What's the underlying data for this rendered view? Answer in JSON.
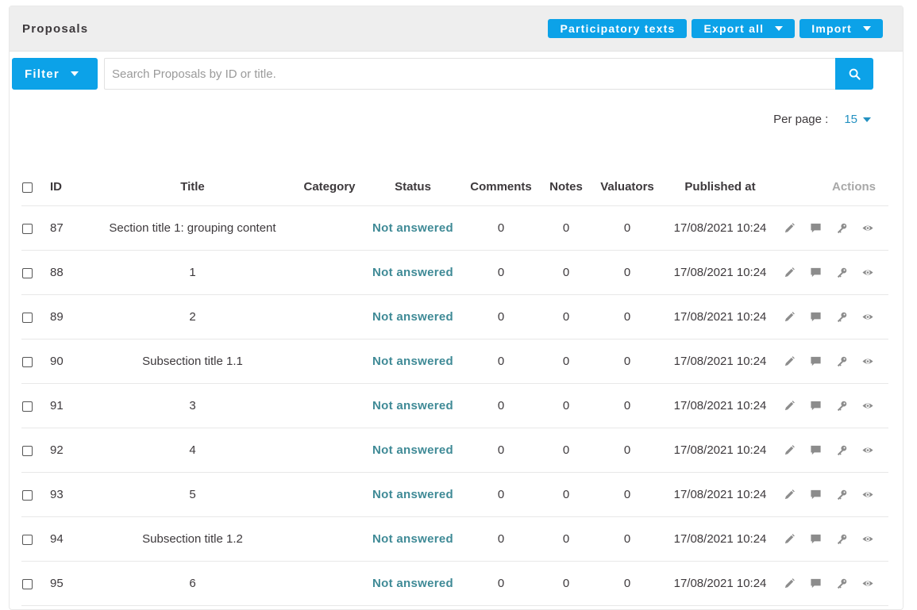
{
  "header": {
    "title": "Proposals",
    "participatory_texts": "Participatory texts",
    "export_all": "Export all",
    "import": "Import"
  },
  "toolbar": {
    "filter": "Filter",
    "search_placeholder": "Search Proposals by ID or title."
  },
  "pagination": {
    "per_page_label": "Per page :",
    "per_page_value": "15"
  },
  "table": {
    "columns": {
      "id": "ID",
      "title": "Title",
      "category": "Category",
      "status": "Status",
      "comments": "Comments",
      "notes": "Notes",
      "valuators": "Valuators",
      "published_at": "Published at",
      "actions": "Actions"
    },
    "rows": [
      {
        "id": "87",
        "title": "Section title 1: grouping content",
        "category": "",
        "status": "Not answered",
        "comments": "0",
        "notes": "0",
        "valuators": "0",
        "published_at": "17/08/2021 10:24"
      },
      {
        "id": "88",
        "title": "1",
        "category": "",
        "status": "Not answered",
        "comments": "0",
        "notes": "0",
        "valuators": "0",
        "published_at": "17/08/2021 10:24"
      },
      {
        "id": "89",
        "title": "2",
        "category": "",
        "status": "Not answered",
        "comments": "0",
        "notes": "0",
        "valuators": "0",
        "published_at": "17/08/2021 10:24"
      },
      {
        "id": "90",
        "title": "Subsection title 1.1",
        "category": "",
        "status": "Not answered",
        "comments": "0",
        "notes": "0",
        "valuators": "0",
        "published_at": "17/08/2021 10:24"
      },
      {
        "id": "91",
        "title": "3",
        "category": "",
        "status": "Not answered",
        "comments": "0",
        "notes": "0",
        "valuators": "0",
        "published_at": "17/08/2021 10:24"
      },
      {
        "id": "92",
        "title": "4",
        "category": "",
        "status": "Not answered",
        "comments": "0",
        "notes": "0",
        "valuators": "0",
        "published_at": "17/08/2021 10:24"
      },
      {
        "id": "93",
        "title": "5",
        "category": "",
        "status": "Not answered",
        "comments": "0",
        "notes": "0",
        "valuators": "0",
        "published_at": "17/08/2021 10:24"
      },
      {
        "id": "94",
        "title": "Subsection title 1.2",
        "category": "",
        "status": "Not answered",
        "comments": "0",
        "notes": "0",
        "valuators": "0",
        "published_at": "17/08/2021 10:24"
      },
      {
        "id": "95",
        "title": "6",
        "category": "",
        "status": "Not answered",
        "comments": "0",
        "notes": "0",
        "valuators": "0",
        "published_at": "17/08/2021 10:24"
      }
    ]
  },
  "icons": {
    "row_actions": [
      "pencil-icon",
      "comment-icon",
      "key-icon",
      "eye-icon"
    ],
    "search": "search-icon",
    "dropdown": "caret-down-icon"
  },
  "colors": {
    "primary": "#0ca2e8",
    "status": "#3f8a96",
    "icon": "#8c8c8c",
    "link": "#2391c1"
  }
}
